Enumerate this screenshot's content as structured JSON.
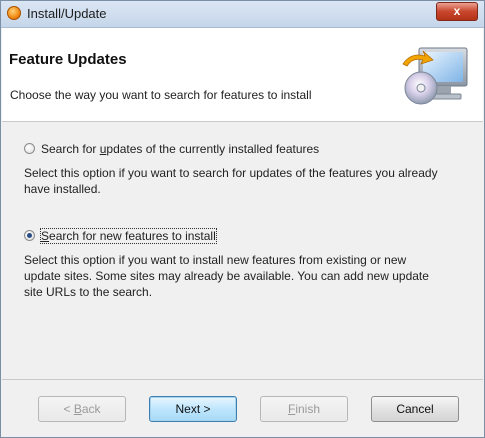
{
  "window": {
    "title": "Install/Update",
    "close_glyph": "x"
  },
  "header": {
    "title": "Feature Updates",
    "description": "Choose the way you want to search for features to install",
    "graphic_icon": "install-wizard-monitor-cd-icon"
  },
  "options": [
    {
      "label_prefix": "Search for ",
      "label_accel": "u",
      "label_suffix": "pdates of the currently installed features",
      "selected": false,
      "description": "Select this option if you want to search for updates of the features you already have installed."
    },
    {
      "label_prefix": "",
      "label_accel": "S",
      "label_suffix": "earch for new features to install",
      "selected": true,
      "description": "Select this option if you want to install new features from existing or new update sites. Some sites may already be available. You can add new update site URLs to the search."
    }
  ],
  "buttons": {
    "back": {
      "prefix": "< ",
      "accel": "B",
      "suffix": "ack",
      "enabled": false
    },
    "next": {
      "label": "Next >",
      "enabled": true,
      "default": true
    },
    "finish": {
      "accel": "F",
      "suffix": "inish",
      "enabled": false
    },
    "cancel": {
      "label": "Cancel",
      "enabled": true
    }
  },
  "colors": {
    "title_bar": "#c5d6ea",
    "close_button": "#c9462c",
    "default_button_border": "#3c7fb1"
  }
}
